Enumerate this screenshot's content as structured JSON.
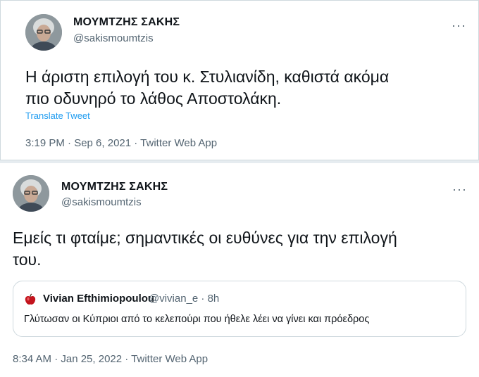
{
  "tweets": [
    {
      "author_name": "ΜΟΥΜΤΖΗΣ ΣΑΚΗΣ",
      "author_handle": "@sakismoumtzis",
      "more": "···",
      "text": "Η άριστη επιλογή του κ. Στυλιανίδη, καθιστά ακόμα\nπιο οδυνηρό το λάθος Αποστολάκη.",
      "translate": "Translate Tweet",
      "meta": "3:19 PM · Sep 6, 2021 · Twitter Web App"
    },
    {
      "author_name": "ΜΟΥΜΤΖΗΣ ΣΑΚΗΣ",
      "author_handle": "@sakismoumtzis",
      "more": "···",
      "text": "Εμείς τι φταίμε; σημαντικές οι ευθύνες για την επιλογή\nτου.",
      "quote": {
        "author_name": "Vivian Efthimiopoulou",
        "handle_time": "@vivian_e · 8h",
        "avatar_icon": "red-apple-icon",
        "text": "Γλύτωσαν οι Κύπριοι από το κελεπούρι που ήθελε λέει να γίνει και πρόεδρος"
      },
      "meta": "8:34 AM · Jan 25, 2022 · Twitter Web App"
    }
  ],
  "colors": {
    "text": "#0f1419",
    "secondary": "#536471",
    "link": "#1d9bf0",
    "border": "#cfd9de"
  }
}
